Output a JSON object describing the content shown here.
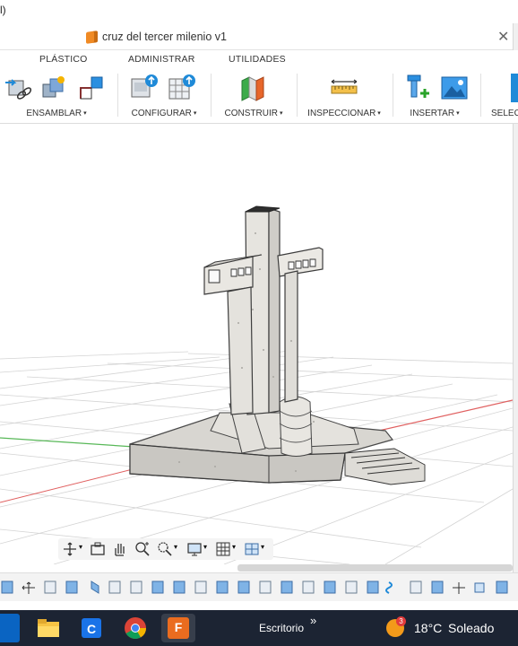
{
  "top_fragment": "l)",
  "document": {
    "title": "cruz del tercer milenio v1",
    "close_glyph": "✕"
  },
  "tabs": [
    "PLÁSTICO",
    "ADMINISTRAR",
    "UTILIDADES"
  ],
  "toolbar": {
    "assemble": "ENSAMBLAR",
    "configure": "CONFIGURAR",
    "construct": "CONSTRUIR",
    "inspect": "INSPECCIONAR",
    "insert": "INSERTAR",
    "select": "SELEC"
  },
  "caret": "▾",
  "taskbar": {
    "desktop_label": "Escritorio",
    "overflow_glyph": "»",
    "weather_temp": "18°C",
    "weather_text": "Soleado",
    "weather_badge": "3",
    "fusion_label": "F"
  },
  "colors": {
    "accent": "#0696d7",
    "model_stone": "#d9d7d2",
    "grid_line": "#d0d0d0",
    "axis_red": "#e06060",
    "axis_green": "#55b855",
    "taskbar": "#1c2433"
  }
}
